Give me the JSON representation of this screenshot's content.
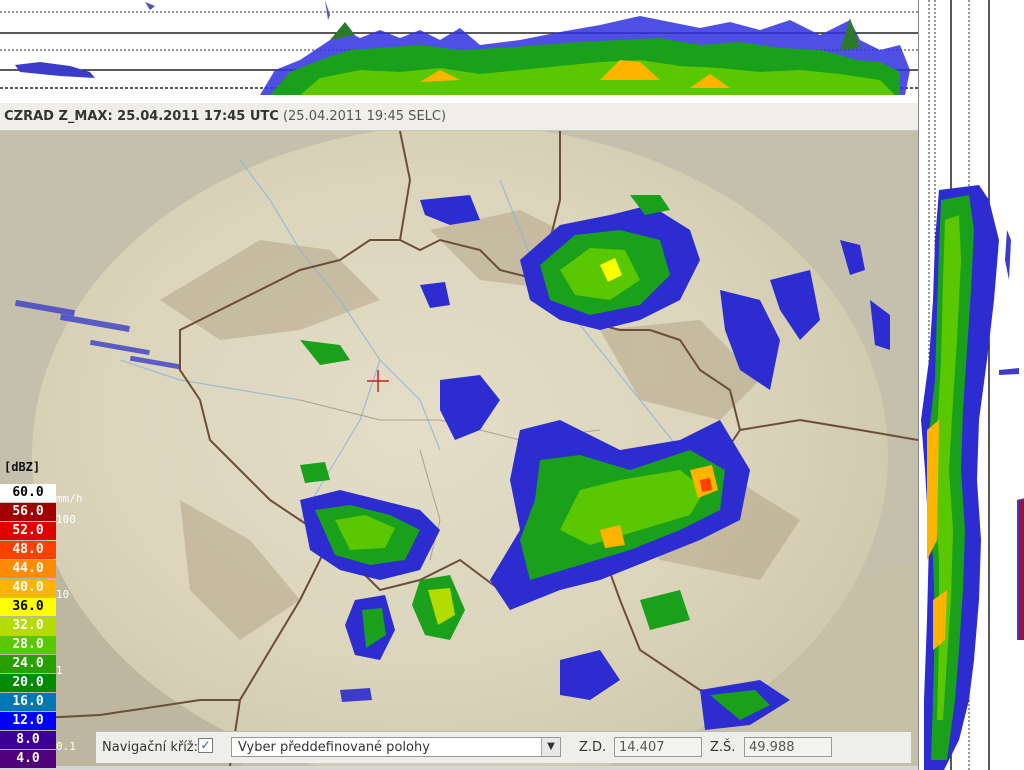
{
  "title": {
    "product": "CZRAD Z_MAX: 25.04.2011 17:45 UTC",
    "local": "(25.04.2011 19:45 SELC)"
  },
  "legend": {
    "unit": "[dBZ]",
    "entries": [
      {
        "label": "60.0",
        "color": "#ffffff",
        "text": "#000000"
      },
      {
        "label": "56.0",
        "color": "#a00000",
        "text": "#ffffff"
      },
      {
        "label": "52.0",
        "color": "#e00000",
        "text": "#ffffff"
      },
      {
        "label": "48.0",
        "color": "#ff4000",
        "text": "#ffffff"
      },
      {
        "label": "44.0",
        "color": "#ff8c00",
        "text": "#ffffff"
      },
      {
        "label": "40.0",
        "color": "#ffb400",
        "text": "#ffffff"
      },
      {
        "label": "36.0",
        "color": "#ffff00",
        "text": "#000000"
      },
      {
        "label": "32.0",
        "color": "#b4dc00",
        "text": "#ffffff"
      },
      {
        "label": "28.0",
        "color": "#5ac800",
        "text": "#ffffff"
      },
      {
        "label": "24.0",
        "color": "#28a000",
        "text": "#ffffff"
      },
      {
        "label": "20.0",
        "color": "#008c00",
        "text": "#ffffff"
      },
      {
        "label": "16.0",
        "color": "#0078b4",
        "text": "#ffffff"
      },
      {
        "label": "12.0",
        "color": "#0000ff",
        "text": "#ffffff"
      },
      {
        "label": "8.0",
        "color": "#3c0096",
        "text": "#ffffff"
      },
      {
        "label": "4.0",
        "color": "#500078",
        "text": "#ffffff"
      }
    ],
    "rate_unit": "mm/h",
    "rates": [
      "100",
      "10",
      "1",
      "0.1"
    ]
  },
  "controls": {
    "nav_cross_label": "Navigační kříž:",
    "nav_cross_checked": true,
    "preset_placeholder": "Vyber předdefinované polohy",
    "lon_label": "Z.D.",
    "lon_value": "14.407",
    "lat_label": "Z.Š.",
    "lat_value": "49.988"
  }
}
